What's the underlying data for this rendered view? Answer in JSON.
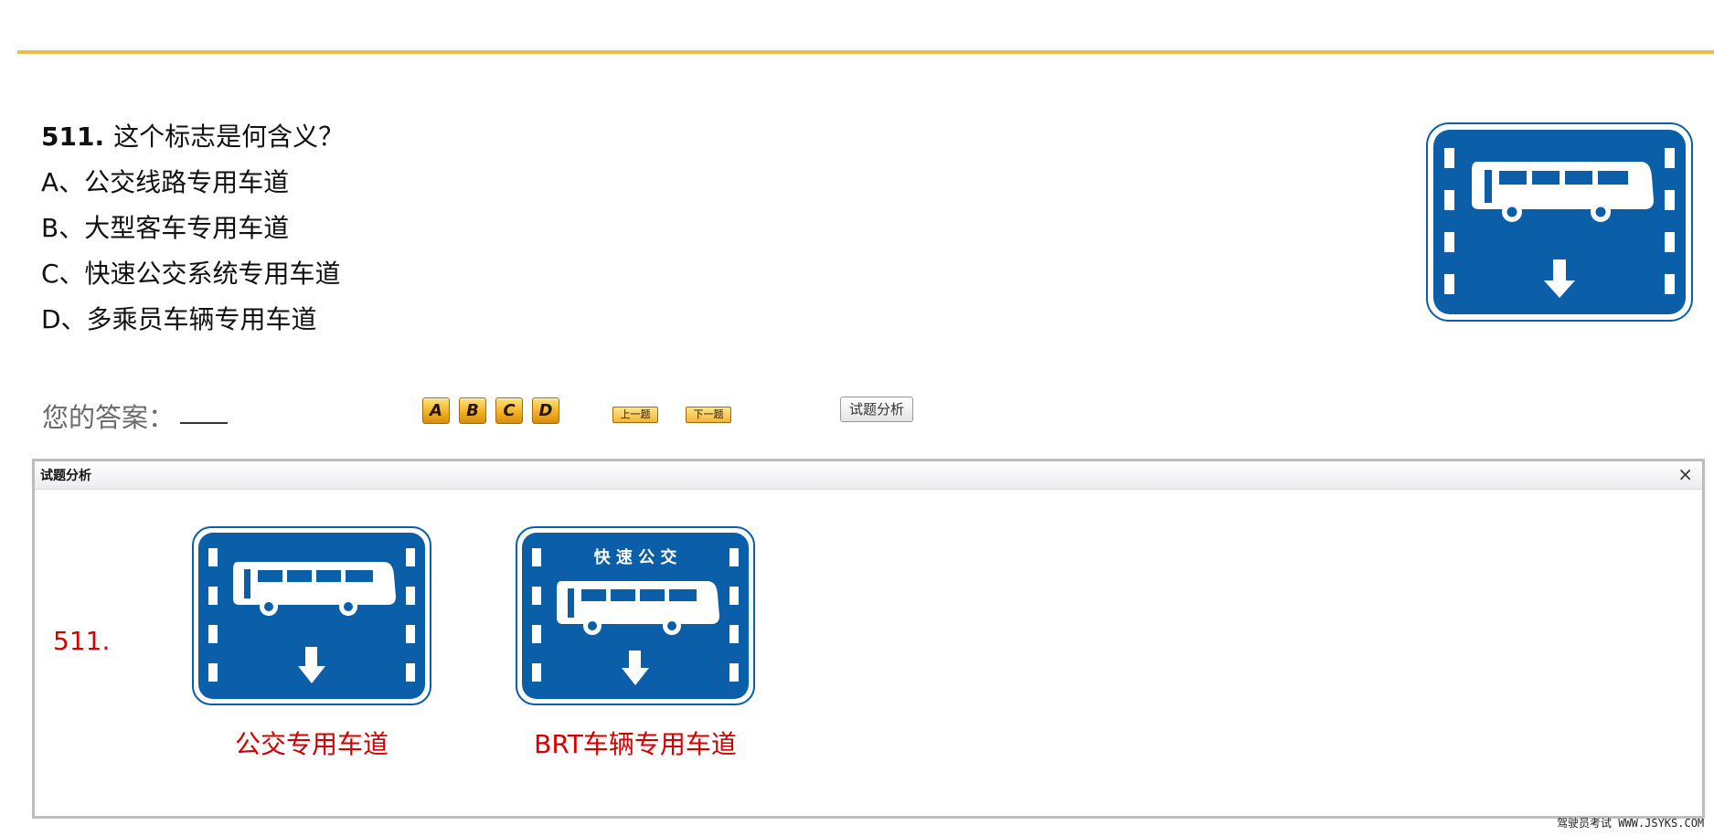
{
  "question": {
    "number": "511.",
    "text": "这个标志是何含义？",
    "options": [
      "A、公交线路专用车道",
      "B、大型客车专用车道",
      "C、快速公交系统专用车道",
      "D、多乘员车辆专用车道"
    ]
  },
  "sign_icon": "bus-lane-sign-icon",
  "answer": {
    "label": "您的答案：",
    "value": ""
  },
  "buttons": {
    "options": [
      "A",
      "B",
      "C",
      "D"
    ],
    "prev": "上一题",
    "next": "下一题",
    "analysis": "试题分析"
  },
  "panel": {
    "title": "试题分析",
    "close": "×",
    "number": "511.",
    "brt_sign_text": "快 速 公 交",
    "captions": [
      "公交专用车道",
      "BRT车辆专用车道"
    ]
  },
  "watermark": "驾驶员考试 WWW.JSYKS.COM",
  "colors": {
    "sign_blue": "#0b5fa8",
    "accent_line": "#e8bf4e",
    "analysis_red": "#d40000"
  }
}
